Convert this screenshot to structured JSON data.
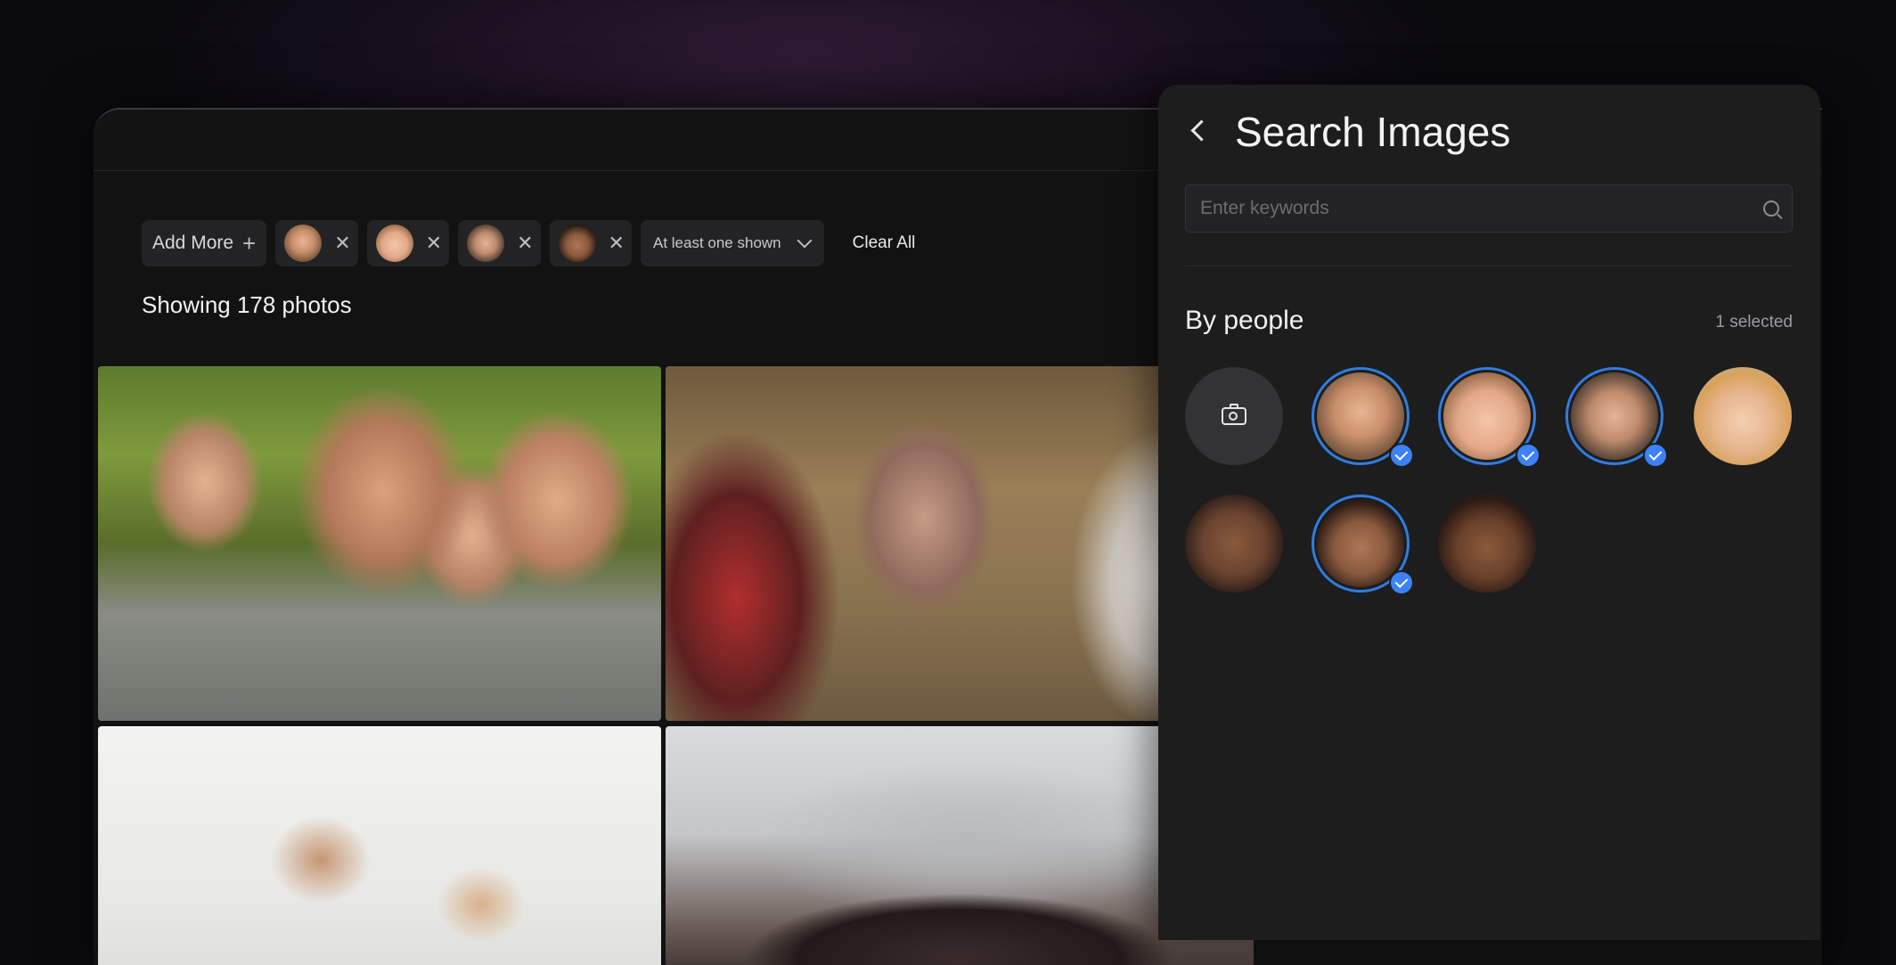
{
  "filters": {
    "add_more_label": "Add More",
    "match_mode": "At least one shown",
    "clear_all_label": "Clear All",
    "people": [
      {
        "name": "man-smiling"
      },
      {
        "name": "baby"
      },
      {
        "name": "bearded-man"
      },
      {
        "name": "woman-smiling"
      }
    ]
  },
  "results": {
    "count_label": "Showing 178 photos"
  },
  "panel": {
    "title": "Search Images",
    "search_placeholder": "Enter keywords",
    "section_title": "By people",
    "selected_count": "1 selected"
  },
  "colors": {
    "accent": "#3b82f6",
    "panel_bg": "#1d1d1e",
    "app_bg": "#121213"
  }
}
